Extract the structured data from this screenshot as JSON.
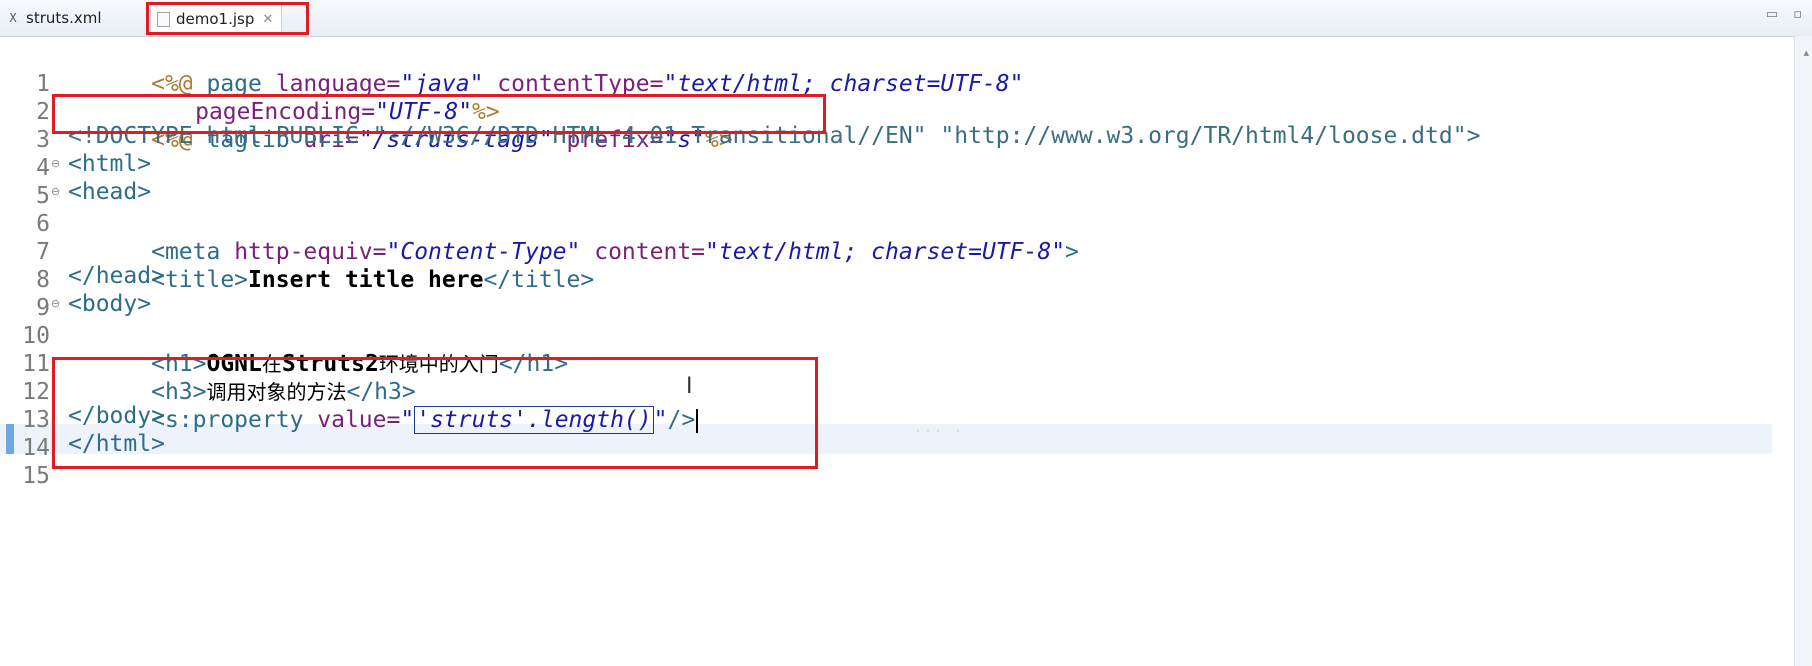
{
  "tabs": [
    {
      "label": "struts.xml",
      "icon": "xml-file-icon",
      "active": false
    },
    {
      "label": "demo1.jsp",
      "icon": "jsp-file-icon",
      "active": true,
      "close_glyph": "✕"
    }
  ],
  "window_controls": {
    "minimize": "▭",
    "restore": "▫"
  },
  "editor": {
    "lines": [
      {
        "n": "1"
      },
      {
        "n": "2"
      },
      {
        "n": "3"
      },
      {
        "n": "4"
      },
      {
        "n": "5"
      },
      {
        "n": "6"
      },
      {
        "n": "7"
      },
      {
        "n": "8"
      },
      {
        "n": "9"
      },
      {
        "n": "10"
      },
      {
        "n": "11"
      },
      {
        "n": "12"
      },
      {
        "n": "13"
      },
      {
        "n": "14"
      },
      {
        "n": "15"
      }
    ],
    "tokens": {
      "l1_open": "<%@",
      "l1_page": " page ",
      "l1_attr1": "language=",
      "l1_val1": "\"java\"",
      "l1_attr2": " contentType=",
      "l1_val2": "\"text/html; charset=UTF-8\"",
      "l2_attr": "pageEncoding=",
      "l2_val": "\"UTF-8\"",
      "l2_close": "%>",
      "l3_open": "<%@",
      "l3_taglib": " taglib ",
      "l3_attr1": "uri=",
      "l3_val1": "\"/struts-tags\"",
      "l3_attr2": " prefix=",
      "l3_val2": "\"s\"",
      "l3_close": "%>",
      "l4": "<!DOCTYPE html PUBLIC \"-//W3C//DTD HTML 4.01 Transitional//EN\" \"http://www.w3.org/TR/html4/loose.dtd\">",
      "l5": "<html>",
      "l6": "<head>",
      "l7_open": "<meta ",
      "l7_attr1": "http-equiv=",
      "l7_val1": "\"Content-Type\"",
      "l7_attr2": " content=",
      "l7_val2": "\"text/html; charset=UTF-8\"",
      "l7_close": ">",
      "l8_open": "<title>",
      "l8_text": "Insert title here",
      "l8_close": "</title>",
      "l9": "</head>",
      "l10": "<body>",
      "l11_open": "<h1>",
      "l11_text1": "OGNL",
      "l11_cn1": "在",
      "l11_text2": "Struts2",
      "l11_cn2": "环境中的入门",
      "l11_close": "</h1>",
      "l12_open": "<h3>",
      "l12_cn": "调用对象的方法",
      "l12_close": "</h3>",
      "l13_open": "<s:property ",
      "l13_attr": "value=",
      "l13_q1": "\"",
      "l13_expr": "'struts'.length()",
      "l13_q2": "\"",
      "l13_close": "/>",
      "l14": "</body>",
      "l15": "</html>"
    }
  },
  "colors": {
    "annotation": "#e01b24",
    "tag": "#2d6c8a",
    "attribute": "#7a1f7a",
    "value": "#1a1aa6",
    "directive": "#b07a30",
    "current_line": "#eef2fb"
  }
}
